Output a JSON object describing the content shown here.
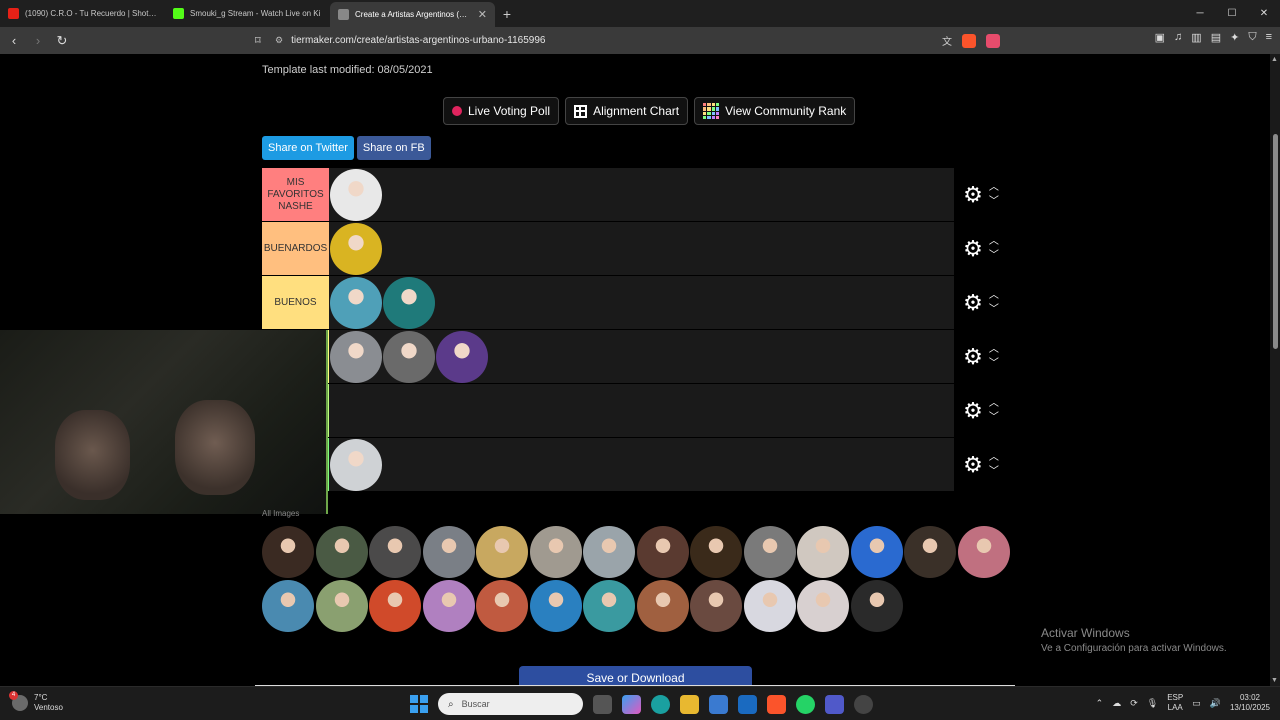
{
  "browser": {
    "tabs": [
      {
        "title": "(1090) C.R.O - Tu Recuerdo | Shot by",
        "favicon_color": "#e62117"
      },
      {
        "title": "Smouki_g Stream - Watch Live on Ki",
        "favicon_color": "#53fc18"
      },
      {
        "title": "Create a Artistas Argentinos (Urb",
        "favicon_color": "#888888"
      }
    ],
    "url": "tiermaker.com/create/artistas-argentinos-urbano-1165996"
  },
  "page": {
    "last_modified": "Template last modified: 08/05/2021",
    "buttons": {
      "live_poll": "Live Voting Poll",
      "alignment_chart": "Alignment Chart",
      "community_rank": "View Community Rank"
    },
    "share": {
      "twitter": "Share on Twitter",
      "facebook": "Share on FB"
    },
    "tiers": [
      {
        "label": "MIS FAVORITOS NASHE",
        "color": "#ff7f7f",
        "avatars": [
          "#e8e8e8"
        ]
      },
      {
        "label": "BUENARDOS",
        "color": "#ffbf7f",
        "avatars": [
          "#d9b422"
        ]
      },
      {
        "label": "BUENOS",
        "color": "#ffdf7f",
        "avatars": [
          "#4fa0b8",
          "#1f7a7a"
        ]
      },
      {
        "label": "",
        "color": "#ffff7f",
        "avatars": [
          "#8a8d92",
          "#6a6a6a",
          "#5b3a8a"
        ]
      },
      {
        "label": "",
        "color": "#bfff7f",
        "avatars": []
      },
      {
        "label": "",
        "color": "#7fff7f",
        "avatars": [
          "#cfd2d5"
        ]
      }
    ],
    "pool_caption": "All Images",
    "pool": [
      "#3a2a22",
      "#4a5a44",
      "#4b4a4a",
      "#7a7f86",
      "#c8a860",
      "#a09a90",
      "#9aa4aa",
      "#5a3a30",
      "#3a2a1a",
      "#7a7a7a",
      "#d0c8c0",
      "#2a6ad0",
      "#3a3028",
      "#c07080",
      "#4a8ab0",
      "#8aa070",
      "#d04a2a",
      "#b080c0",
      "#c05a40",
      "#2a80c0",
      "#3a9aa0",
      "#a06040",
      "#6a4a40",
      "#d8d8e0",
      "#d8d0d0",
      "#2a2a2a"
    ],
    "save_button": "Save or Download",
    "activate": {
      "title": "Activar Windows",
      "subtitle": "Ve a Configuración para activar Windows."
    }
  },
  "taskbar": {
    "weather_temp": "7°C",
    "weather_desc": "Ventoso",
    "weather_badge": "4",
    "search_placeholder": "Buscar",
    "lang_top": "ESP",
    "lang_bottom": "LAA",
    "time": "03:02",
    "date": "13/10/2025"
  },
  "colors": {
    "accent_twitter": "#1d9be3",
    "accent_facebook": "#3b5998",
    "save_button": "#2d4ea0"
  }
}
